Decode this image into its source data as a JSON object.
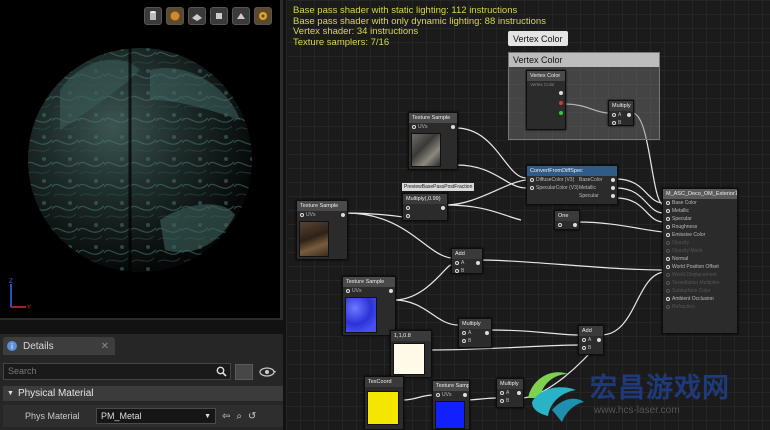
{
  "viewport": {
    "toolbar_icons": [
      "mesh-cylinder-icon",
      "mesh-sphere-icon",
      "mesh-plane-icon",
      "mesh-cube-icon",
      "mesh-custom-icon",
      "realtime-icon"
    ]
  },
  "details": {
    "tab_label": "Details",
    "search_placeholder": "Search",
    "section_title": "Physical Material",
    "property_label": "Phys Material",
    "property_value": "PM_Metal"
  },
  "graph": {
    "stats": [
      "Base pass shader with static lighting: 112 instructions",
      "Base pass shader with only dynamic lighting: 88 instructions",
      "Vertex shader: 34 instructions",
      "Texture samplers: 7/16"
    ],
    "tooltip": "Vertex Color",
    "comment_title": "Vertex Color",
    "nodes": {
      "vertex_color": {
        "title": "Vertex Color",
        "sub": "Vertex Color"
      },
      "multiply_top": {
        "title": "Multiply",
        "pins": [
          "A",
          "B"
        ]
      },
      "texture_sample_1": {
        "title": "Texture Sample",
        "uvs": "UVs"
      },
      "convert_spec": {
        "title": "ConvertFromDiffSpec",
        "inputs": [
          "DiffuseColor (V3)",
          "SpecularColor (V3)"
        ],
        "outputs": [
          "BaseColor",
          "Metallic",
          "Specular"
        ]
      },
      "preview_chip": "PreviewBasePassPostFraction",
      "multiply_mid": {
        "title": "Multiply(,0.99)"
      },
      "texture_sample_2": {
        "title": "Texture Sample",
        "uvs": "UVs"
      },
      "one_minus": {
        "title": "One"
      },
      "material_result": {
        "title": "M_ASC_Deco_OM_Exterior1",
        "pins": [
          "Base Color",
          "Metallic",
          "Specular",
          "Roughness",
          "Emissive Color",
          "Opacity",
          "Opacity Mask",
          "Normal",
          "World Position Offset",
          "World Displacement",
          "Tessellation Multiplier",
          "Subsurface Color",
          "Ambient Occlusion",
          "Refraction"
        ]
      },
      "add_1": {
        "title": "Add",
        "pins": [
          "A",
          "B"
        ]
      },
      "texture_sample_3": {
        "title": "Texture Sample",
        "uvs": "UVs"
      },
      "multiply_2": {
        "title": "Multiply",
        "pins": [
          "A",
          "B"
        ]
      },
      "constant_1": {
        "title": "1,1,0.8"
      },
      "add_2": {
        "title": "Add",
        "pins": [
          "A",
          "B"
        ]
      },
      "texcoord": {
        "title": "TexCoord"
      },
      "texture_sample_4": {
        "title": "Texture Sample",
        "uvs": "UVs"
      },
      "multiply_3": {
        "title": "Multiply",
        "pins": [
          "A",
          "B"
        ]
      }
    }
  },
  "watermark": {
    "title": "宏昌游戏网",
    "url": "www.hcs-laser.com"
  },
  "colors": {
    "stats_text": "#d9d94a",
    "swatch_white": "#fffbe8",
    "swatch_yellow": "#f5e600",
    "swatch_blue": "#1020ff"
  }
}
